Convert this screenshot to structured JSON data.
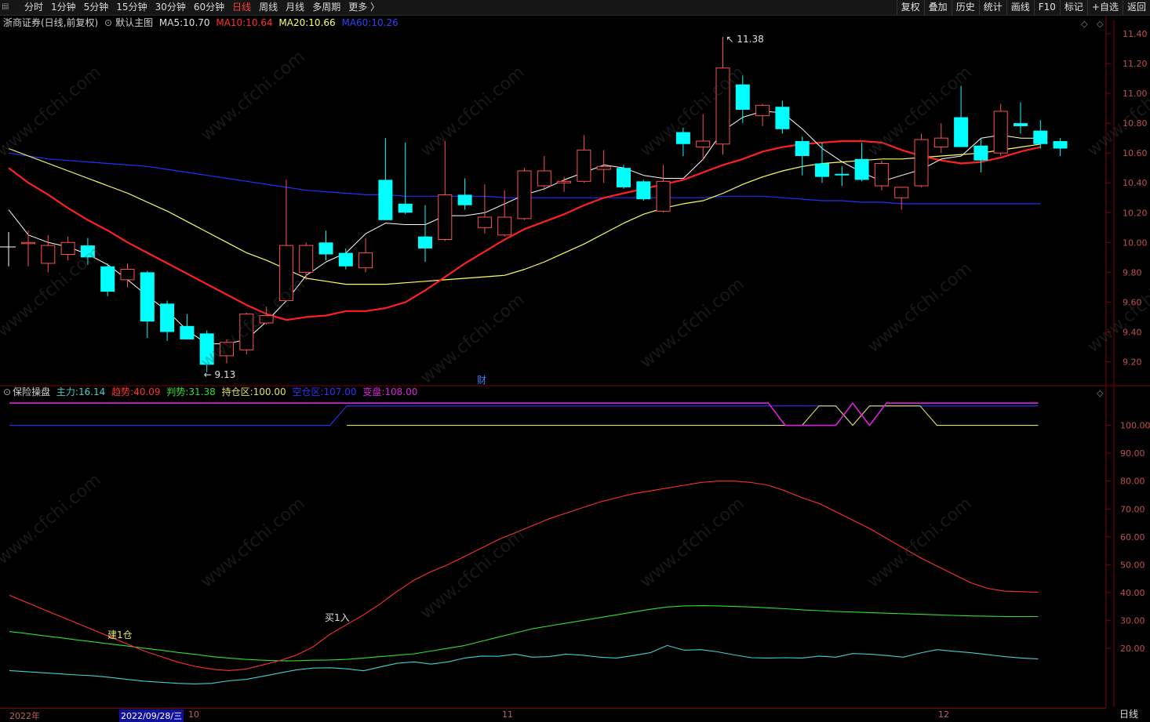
{
  "toolbar": {
    "period_tabs": [
      "分时",
      "1分钟",
      "5分钟",
      "15分钟",
      "30分钟",
      "60分钟",
      "日线",
      "周线",
      "月线",
      "多周期",
      "更多 〉"
    ],
    "active_tab": "日线",
    "right_buttons": [
      "复权",
      "叠加",
      "历史",
      "统计",
      "画线",
      "F10",
      "标记",
      "+自选",
      "返回"
    ]
  },
  "main_header": {
    "stock": "浙商证券(日线,前复权)",
    "template": "默认主图",
    "ma5_label": "MA5:",
    "ma5": "10.70",
    "ma10_label": "MA10:",
    "ma10": "10.64",
    "ma20_label": "MA20:",
    "ma20": "10.66",
    "ma60_label": "MA60:",
    "ma60": "10.26"
  },
  "sub_header": {
    "name": "保险操盘",
    "zhuli_label": "主力:",
    "zhuli": "16.14",
    "qushi_label": "趋势:",
    "qushi": "40.09",
    "panshi_label": "判势:",
    "panshi": "31.38",
    "chicang_label": "持仓区:",
    "chicang": "100.00",
    "kongcang_label": "空仓区:",
    "kongcang": "107.00",
    "bianpan_label": "变盘:",
    "bianpan": "108.00"
  },
  "annotations": {
    "high": "11.38",
    "low": "9.13",
    "cai": "财",
    "jiancang": "建1仓",
    "mairu": "买1入"
  },
  "date_axis": {
    "year": "2022年",
    "cursor": "2022/09/28/三",
    "m10": "10",
    "m11": "11",
    "m12": "12"
  },
  "period_label": "日线",
  "watermark": "www.cfchi.com",
  "colors": {
    "up": "#ff5050",
    "down": "#00ffff",
    "ma5": "#ffffff",
    "ma10": "#ff2020",
    "ma20": "#ffff60",
    "ma60": "#2030ff",
    "qushi": "#ff3030",
    "panshi": "#30e030",
    "zhuli": "#40d0d0",
    "chicang": "#e0e060",
    "kongcang": "#3030ff",
    "bianpan": "#e020e0",
    "axis": "#800000"
  },
  "chart_data": [
    {
      "type": "candlestick",
      "title": "浙商证券(日线,前复权)",
      "ylim": [
        9.05,
        11.5
      ],
      "yticks": [
        9.2,
        9.4,
        9.6,
        9.8,
        10.0,
        10.2,
        10.4,
        10.6,
        10.8,
        11.0,
        11.2,
        11.4
      ],
      "candles": [
        {
          "o": 10.0,
          "h": 10.08,
          "l": 9.84,
          "c": 10.0
        },
        {
          "o": 9.86,
          "h": 10.05,
          "l": 9.8,
          "c": 9.98
        },
        {
          "o": 9.92,
          "h": 10.04,
          "l": 9.88,
          "c": 10.0
        },
        {
          "o": 9.98,
          "h": 10.03,
          "l": 9.85,
          "c": 9.9
        },
        {
          "o": 9.84,
          "h": 9.86,
          "l": 9.64,
          "c": 9.67
        },
        {
          "o": 9.75,
          "h": 9.86,
          "l": 9.7,
          "c": 9.82
        },
        {
          "o": 9.8,
          "h": 9.81,
          "l": 9.36,
          "c": 9.47
        },
        {
          "o": 9.59,
          "h": 9.61,
          "l": 9.34,
          "c": 9.4
        },
        {
          "o": 9.44,
          "h": 9.52,
          "l": 9.35,
          "c": 9.35
        },
        {
          "o": 9.39,
          "h": 9.41,
          "l": 9.13,
          "c": 9.18
        },
        {
          "o": 9.24,
          "h": 9.35,
          "l": 9.19,
          "c": 9.33
        },
        {
          "o": 9.28,
          "h": 9.53,
          "l": 9.25,
          "c": 9.52
        },
        {
          "o": 9.46,
          "h": 9.57,
          "l": 9.45,
          "c": 9.51
        },
        {
          "o": 9.61,
          "h": 10.42,
          "l": 9.6,
          "c": 9.98
        },
        {
          "o": 9.8,
          "h": 10.0,
          "l": 9.75,
          "c": 9.98
        },
        {
          "o": 10.0,
          "h": 10.08,
          "l": 9.88,
          "c": 9.92
        },
        {
          "o": 9.93,
          "h": 9.96,
          "l": 9.82,
          "c": 9.84
        },
        {
          "o": 9.83,
          "h": 10.03,
          "l": 9.8,
          "c": 9.93
        },
        {
          "o": 10.42,
          "h": 10.7,
          "l": 10.15,
          "c": 10.15
        },
        {
          "o": 10.26,
          "h": 10.67,
          "l": 10.19,
          "c": 10.2
        },
        {
          "o": 10.04,
          "h": 10.25,
          "l": 9.87,
          "c": 9.96
        },
        {
          "o": 10.02,
          "h": 10.68,
          "l": 10.01,
          "c": 10.32
        },
        {
          "o": 10.32,
          "h": 10.43,
          "l": 10.22,
          "c": 10.25
        },
        {
          "o": 10.1,
          "h": 10.39,
          "l": 10.06,
          "c": 10.17
        },
        {
          "o": 10.05,
          "h": 10.35,
          "l": 10.04,
          "c": 10.17
        },
        {
          "o": 10.16,
          "h": 10.5,
          "l": 10.15,
          "c": 10.48
        },
        {
          "o": 10.38,
          "h": 10.58,
          "l": 10.35,
          "c": 10.48
        },
        {
          "o": 10.4,
          "h": 10.44,
          "l": 10.34,
          "c": 10.41
        },
        {
          "o": 10.41,
          "h": 10.72,
          "l": 10.4,
          "c": 10.62
        },
        {
          "o": 10.49,
          "h": 10.62,
          "l": 10.4,
          "c": 10.51
        },
        {
          "o": 10.5,
          "h": 10.52,
          "l": 10.36,
          "c": 10.37
        },
        {
          "o": 10.41,
          "h": 10.42,
          "l": 10.28,
          "c": 10.29
        },
        {
          "o": 10.21,
          "h": 10.52,
          "l": 10.2,
          "c": 10.41
        },
        {
          "o": 10.74,
          "h": 10.77,
          "l": 10.58,
          "c": 10.66
        },
        {
          "o": 10.64,
          "h": 10.86,
          "l": 10.55,
          "c": 10.68
        },
        {
          "o": 10.66,
          "h": 11.38,
          "l": 10.59,
          "c": 11.17
        },
        {
          "o": 11.06,
          "h": 11.12,
          "l": 10.8,
          "c": 10.89
        },
        {
          "o": 10.85,
          "h": 10.93,
          "l": 10.78,
          "c": 10.92
        },
        {
          "o": 10.91,
          "h": 10.95,
          "l": 10.73,
          "c": 10.76
        },
        {
          "o": 10.68,
          "h": 10.71,
          "l": 10.45,
          "c": 10.58
        },
        {
          "o": 10.53,
          "h": 10.67,
          "l": 10.4,
          "c": 10.44
        },
        {
          "o": 10.46,
          "h": 10.51,
          "l": 10.38,
          "c": 10.45
        },
        {
          "o": 10.56,
          "h": 10.67,
          "l": 10.41,
          "c": 10.42
        },
        {
          "o": 10.38,
          "h": 10.55,
          "l": 10.35,
          "c": 10.53
        },
        {
          "o": 10.3,
          "h": 10.37,
          "l": 10.22,
          "c": 10.37
        },
        {
          "o": 10.38,
          "h": 10.73,
          "l": 10.37,
          "c": 10.69
        },
        {
          "o": 10.64,
          "h": 10.8,
          "l": 10.6,
          "c": 10.7
        },
        {
          "o": 10.84,
          "h": 11.05,
          "l": 10.64,
          "c": 10.64
        },
        {
          "o": 10.65,
          "h": 10.7,
          "l": 10.47,
          "c": 10.55
        },
        {
          "o": 10.6,
          "h": 10.93,
          "l": 10.58,
          "c": 10.88
        },
        {
          "o": 10.8,
          "h": 10.94,
          "l": 10.73,
          "c": 10.78
        },
        {
          "o": 10.75,
          "h": 10.82,
          "l": 10.63,
          "c": 10.66
        },
        {
          "o": 10.68,
          "h": 10.7,
          "l": 10.58,
          "c": 10.63
        }
      ],
      "ma5": [
        10.22,
        10.05,
        10.0,
        9.97,
        9.92,
        9.85,
        9.75,
        9.64,
        9.54,
        9.41,
        9.32,
        9.32,
        9.35,
        9.47,
        9.61,
        9.78,
        9.87,
        9.93,
        10.06,
        10.13,
        10.12,
        10.12,
        10.18,
        10.18,
        10.2,
        10.26,
        10.32,
        10.36,
        10.42,
        10.47,
        10.52,
        10.5,
        10.45,
        10.43,
        10.43,
        10.56,
        10.75,
        10.84,
        10.88,
        10.87,
        10.76,
        10.63,
        10.54,
        10.47,
        10.41,
        10.45,
        10.49,
        10.56,
        10.58,
        10.7,
        10.72,
        10.7,
        10.7
      ],
      "ma10": [
        10.5,
        10.4,
        10.32,
        10.23,
        10.15,
        10.08,
        10.0,
        9.93,
        9.86,
        9.79,
        9.72,
        9.65,
        9.58,
        9.52,
        9.48,
        9.5,
        9.51,
        9.54,
        9.54,
        9.56,
        9.6,
        9.68,
        9.77,
        9.86,
        9.94,
        10.02,
        10.09,
        10.14,
        10.19,
        10.25,
        10.3,
        10.33,
        10.36,
        10.39,
        10.42,
        10.47,
        10.52,
        10.56,
        10.61,
        10.64,
        10.66,
        10.67,
        10.68,
        10.68,
        10.67,
        10.62,
        10.58,
        10.55,
        10.53,
        10.54,
        10.57,
        10.61,
        10.64
      ],
      "ma20": [
        10.63,
        10.58,
        10.53,
        10.48,
        10.43,
        10.38,
        10.33,
        10.27,
        10.21,
        10.14,
        10.07,
        10.0,
        9.93,
        9.88,
        9.82,
        9.76,
        9.74,
        9.72,
        9.72,
        9.72,
        9.73,
        9.74,
        9.75,
        9.76,
        9.77,
        9.78,
        9.82,
        9.87,
        9.93,
        9.99,
        10.06,
        10.13,
        10.19,
        10.23,
        10.26,
        10.28,
        10.33,
        10.39,
        10.44,
        10.48,
        10.51,
        10.53,
        10.54,
        10.55,
        10.56,
        10.56,
        10.57,
        10.58,
        10.59,
        10.6,
        10.62,
        10.64,
        10.66
      ],
      "ma60": [
        10.6,
        10.58,
        10.56,
        10.55,
        10.54,
        10.53,
        10.52,
        10.51,
        10.49,
        10.47,
        10.45,
        10.43,
        10.41,
        10.39,
        10.37,
        10.35,
        10.34,
        10.33,
        10.32,
        10.32,
        10.31,
        10.31,
        10.31,
        10.31,
        10.31,
        10.3,
        10.3,
        10.3,
        10.3,
        10.3,
        10.3,
        10.3,
        10.3,
        10.3,
        10.3,
        10.3,
        10.31,
        10.31,
        10.31,
        10.3,
        10.29,
        10.28,
        10.28,
        10.27,
        10.27,
        10.26,
        10.26,
        10.26,
        10.26,
        10.26,
        10.26,
        10.26,
        10.26
      ]
    },
    {
      "type": "line",
      "title": "保险操盘",
      "ylim": [
        0,
        112
      ],
      "yticks": [
        20.0,
        30.0,
        40.0,
        50.0,
        60.0,
        70.0,
        80.0,
        90.0,
        100.0
      ],
      "series": [
        {
          "name": "趋势",
          "values": [
            39,
            36.5,
            34,
            31.5,
            29,
            26.5,
            24,
            21.5,
            19,
            17,
            15,
            13.5,
            12.5,
            12,
            12.5,
            14,
            15.5,
            17.5,
            20.5,
            25,
            28.5,
            32,
            36,
            40.5,
            44.5,
            47.5,
            50,
            53,
            56,
            59,
            61.5,
            64,
            66.5,
            68.5,
            70.5,
            72.5,
            74,
            75.5,
            76.5,
            77.5,
            78.5,
            79.5,
            80,
            80,
            79.5,
            78.5,
            76.5,
            74,
            72,
            69,
            66,
            63,
            59.5,
            56,
            52.5,
            49.5,
            46.5,
            43.5,
            41.5,
            40.5,
            40.3,
            40.1
          ]
        },
        {
          "name": "判势",
          "values": [
            26,
            25.3,
            24.5,
            23.8,
            23,
            22.3,
            21.5,
            20.8,
            20,
            19.3,
            18.5,
            17.8,
            17,
            16.5,
            16,
            15.7,
            15.5,
            15.5,
            15.7,
            15.8,
            16,
            16.5,
            17,
            17.5,
            18,
            19,
            20,
            21,
            22.5,
            24,
            25.5,
            27,
            28,
            29,
            30,
            31,
            32,
            33,
            34,
            34.8,
            35.2,
            35.3,
            35.2,
            35,
            34.8,
            34.5,
            34.2,
            33.8,
            33.5,
            33.2,
            33,
            32.8,
            32.6,
            32.4,
            32.2,
            32,
            31.8,
            31.6,
            31.5,
            31.4,
            31.38,
            31.38
          ]
        },
        {
          "name": "主力",
          "values": [
            12,
            11.6,
            11.2,
            10.8,
            10.4,
            10.1,
            9.5,
            8.8,
            8.2,
            7.8,
            7.4,
            7.2,
            7.4,
            8.3,
            8.8,
            9.9,
            11.1,
            12.2,
            12.9,
            13,
            12.6,
            11.9,
            13.3,
            14.6,
            15.1,
            14.3,
            15.1,
            16.5,
            17.2,
            17.1,
            17.9,
            16.8,
            17,
            17.9,
            17.5,
            16.8,
            16.5,
            17.4,
            18.4,
            21,
            19.3,
            19.5,
            18.7,
            17.6,
            16.6,
            16.5,
            16.6,
            16.5,
            17.2,
            16.8,
            18.1,
            17.9,
            17.4,
            16.8,
            18.3,
            19.5,
            18.9,
            18.4,
            17.7,
            17,
            16.5,
            16.14
          ]
        },
        {
          "name": "持仓区",
          "values": [
            null,
            null,
            null,
            null,
            null,
            null,
            null,
            null,
            null,
            null,
            null,
            null,
            null,
            null,
            null,
            null,
            null,
            null,
            null,
            null,
            100,
            100,
            100,
            100,
            100,
            100,
            100,
            100,
            100,
            100,
            100,
            100,
            100,
            100,
            100,
            100,
            100,
            100,
            100,
            100,
            100,
            100,
            100,
            100,
            100,
            100,
            100,
            100,
            107,
            107,
            100,
            107,
            107,
            107,
            107,
            100,
            100,
            100,
            100,
            100,
            100,
            100
          ]
        },
        {
          "name": "空仓区",
          "values": [
            100,
            100,
            100,
            100,
            100,
            100,
            100,
            100,
            100,
            100,
            100,
            100,
            100,
            100,
            100,
            100,
            100,
            100,
            100,
            100,
            107,
            107,
            107,
            107,
            107,
            107,
            107,
            107,
            107,
            107,
            107,
            107,
            107,
            107,
            107,
            107,
            107,
            107,
            107,
            107,
            107,
            107,
            107,
            107,
            107,
            107,
            107,
            107,
            107,
            107,
            100,
            107,
            107,
            107,
            107,
            107,
            107,
            107,
            107,
            107,
            107,
            107
          ]
        },
        {
          "name": "变盘",
          "values": [
            108,
            108,
            108,
            108,
            108,
            108,
            108,
            108,
            108,
            108,
            108,
            108,
            108,
            108,
            108,
            108,
            108,
            108,
            108,
            108,
            108,
            108,
            108,
            108,
            108,
            108,
            108,
            108,
            108,
            108,
            108,
            108,
            108,
            108,
            108,
            108,
            108,
            108,
            108,
            108,
            108,
            108,
            108,
            108,
            108,
            108,
            100,
            100,
            100,
            100,
            108,
            100,
            108,
            108,
            108,
            108,
            108,
            108,
            108,
            108,
            108,
            108
          ]
        }
      ]
    }
  ]
}
